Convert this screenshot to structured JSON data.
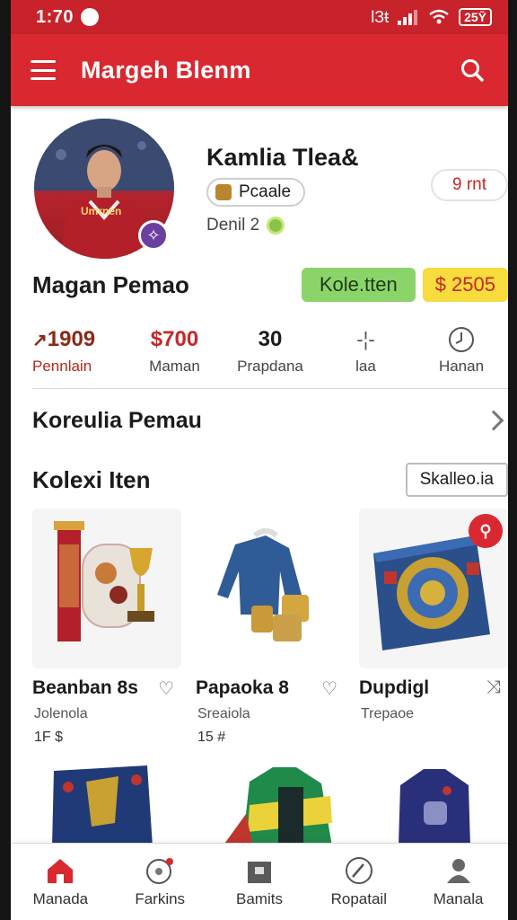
{
  "status_bar": {
    "time": "1:70",
    "signal_text": "lЗŧ",
    "battery": "25Ȳ"
  },
  "app_bar": {
    "title": "Margeh Blenm"
  },
  "profile": {
    "name": "Kamlia Tlea&",
    "role": "Pcaale",
    "level": "Denil 2",
    "id_chip": "9 rnt",
    "avatar_shirt_text": "Umrnen"
  },
  "seller": {
    "label": "Magan Pemao",
    "collect_button": "Kole.tten",
    "price_button": "$ 2505"
  },
  "stats": [
    {
      "value": "1909",
      "label": "Pennlain"
    },
    {
      "value": "$700",
      "label": "Maman"
    },
    {
      "value": "30",
      "label": "Prapdana"
    },
    {
      "value": "-¦-",
      "label": "laa"
    },
    {
      "value": "",
      "label": "Hanan"
    }
  ],
  "collection_link": {
    "label": "Koreulia Pemau"
  },
  "items_section": {
    "title": "Kolexi Iten",
    "sort_button": "Skalleo.ia"
  },
  "items": [
    {
      "name": "Beanban 8s",
      "subtitle": "Jolenola",
      "price": "1F $"
    },
    {
      "name": "Papaoka 8",
      "subtitle": "Sreaiola",
      "price": "15 #"
    },
    {
      "name": "Dupdigl",
      "subtitle": "Trepaoe",
      "price": ""
    }
  ],
  "bottom_nav": [
    {
      "label": "Manada",
      "icon": "home-icon"
    },
    {
      "label": "Farkins",
      "icon": "ball-icon"
    },
    {
      "label": "Bamits",
      "icon": "bag-icon"
    },
    {
      "label": "Ropatail",
      "icon": "compass-icon"
    },
    {
      "label": "Manala",
      "icon": "person-icon"
    }
  ],
  "colors": {
    "primary": "#d9282f",
    "accent_green": "#8bd46a",
    "accent_yellow": "#f6dc3c"
  }
}
